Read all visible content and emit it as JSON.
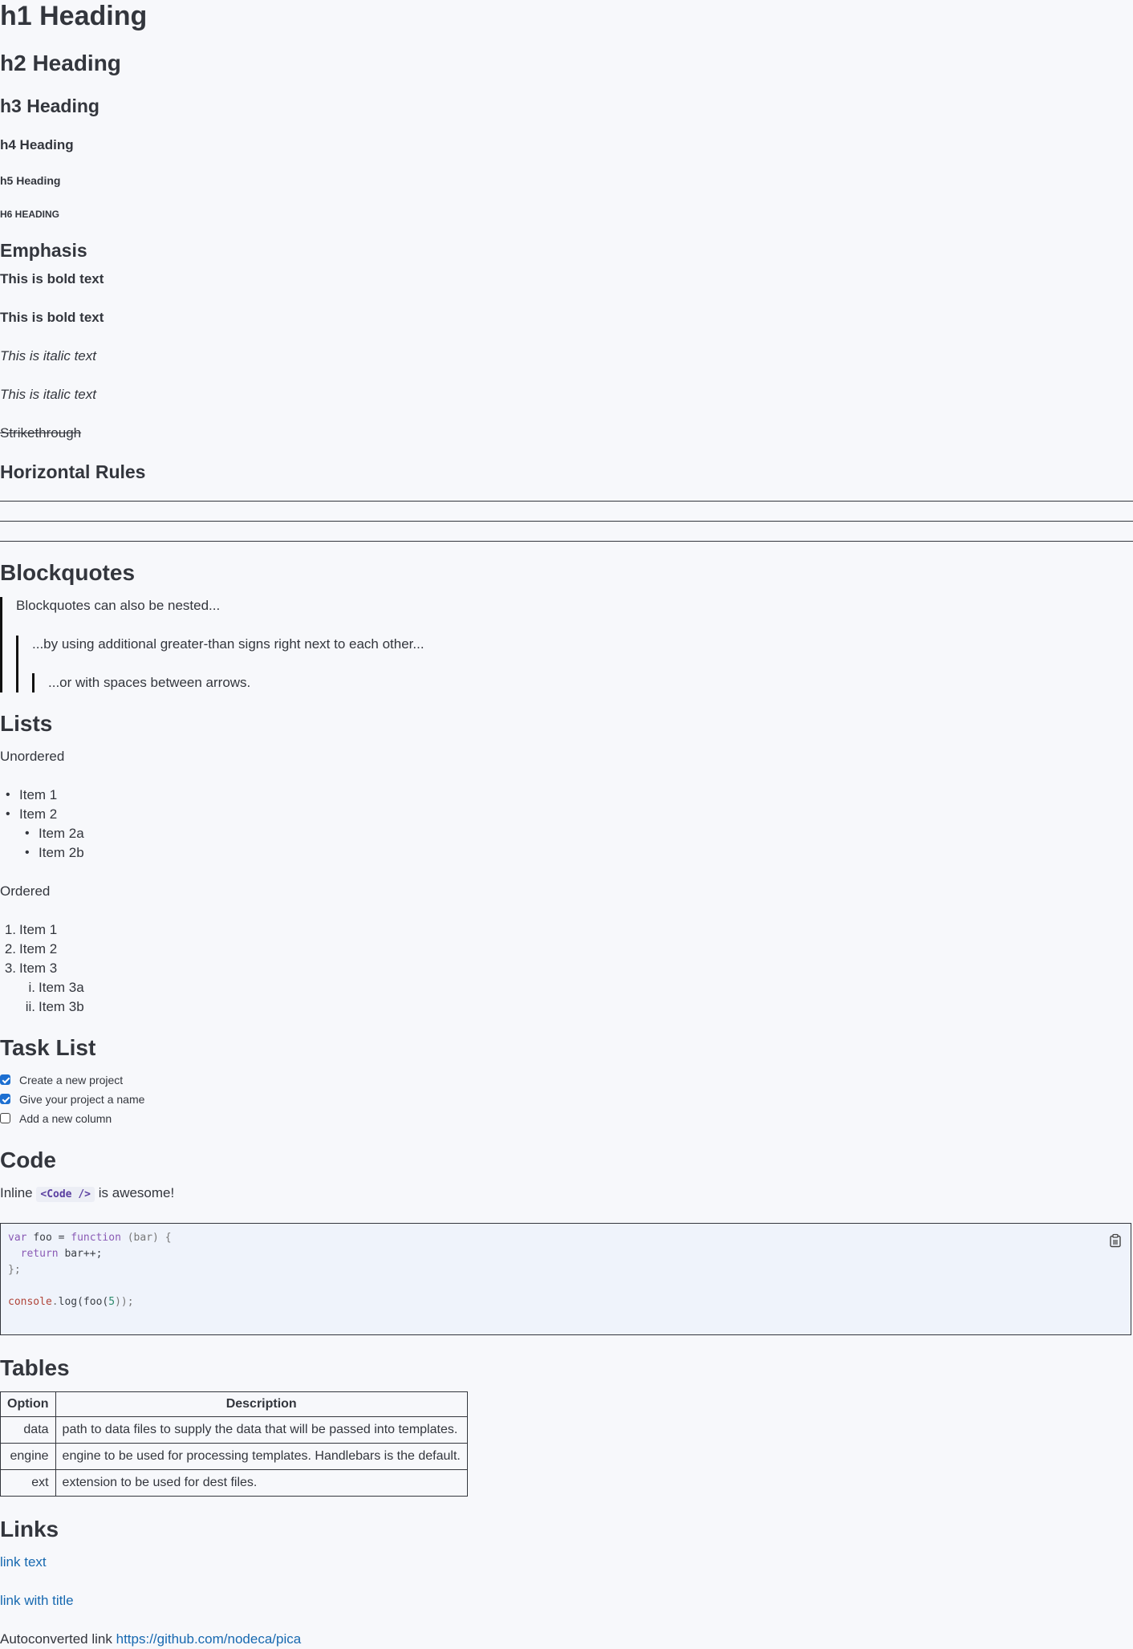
{
  "headings": {
    "h1": "h1 Heading",
    "h2": "h2 Heading",
    "h3": "h3 Heading",
    "h4": "h4 Heading",
    "h5": "h5 Heading",
    "h6": "h6 Heading"
  },
  "emphasis": {
    "title": "Emphasis",
    "bold1": "This is bold text",
    "bold2": "This is bold text",
    "italic1": "This is italic text",
    "italic2": "This is italic text",
    "strike": "Strikethrough"
  },
  "rules": {
    "title": "Horizontal Rules"
  },
  "blockquotes": {
    "title": "Blockquotes",
    "level1": "Blockquotes can also be nested...",
    "level2": "...by using additional greater-than signs right next to each other...",
    "level3": "...or with spaces between arrows."
  },
  "lists": {
    "title": "Lists",
    "unordered_label": "Unordered",
    "unordered": [
      "Item 1",
      "Item 2",
      "Item 2a",
      "Item 2b"
    ],
    "ordered_label": "Ordered",
    "ordered": [
      "Item 1",
      "Item 2",
      "Item 3",
      "Item 3a",
      "Item 3b"
    ],
    "ordered_markers": [
      "1.",
      "2.",
      "3.",
      "i.",
      "ii."
    ]
  },
  "tasks": {
    "title": "Task List",
    "items": [
      {
        "label": "Create a new project",
        "checked": true
      },
      {
        "label": "Give your project a name",
        "checked": true
      },
      {
        "label": "Add a new column",
        "checked": false
      }
    ]
  },
  "code": {
    "title": "Code",
    "inline_before": "Inline",
    "inline_code": "<Code />",
    "inline_after": "is awesome!",
    "block_tokens": {
      "l1_var": "var",
      "l1_foo": "foo",
      "l1_eq": "=",
      "l1_function": "function",
      "l1_args": "(bar) {",
      "l2_return": "return",
      "l2_rest": "bar++;",
      "l3": "};",
      "l5_console": "console",
      "l5_dot": ".",
      "l5_log": "log(foo(",
      "l5_num": "5",
      "l5_end": "));"
    },
    "copy_icon": "clipboard-icon"
  },
  "tables": {
    "title": "Tables",
    "headers": [
      "Option",
      "Description"
    ],
    "rows": [
      [
        "data",
        "path to data files to supply the data that will be passed into templates."
      ],
      [
        "engine",
        "engine to be used for processing templates. Handlebars is the default."
      ],
      [
        "ext",
        "extension to be used for dest files."
      ]
    ]
  },
  "links": {
    "title": "Links",
    "link1": "link text",
    "link2": "link with title",
    "auto_prefix": "Autoconverted link",
    "auto_url": "https://github.com/nodeca/pica"
  },
  "colors": {
    "background": "#f7f8fb",
    "text": "#33363d",
    "link": "#1769b0",
    "checkbox": "#1d6fd1"
  }
}
